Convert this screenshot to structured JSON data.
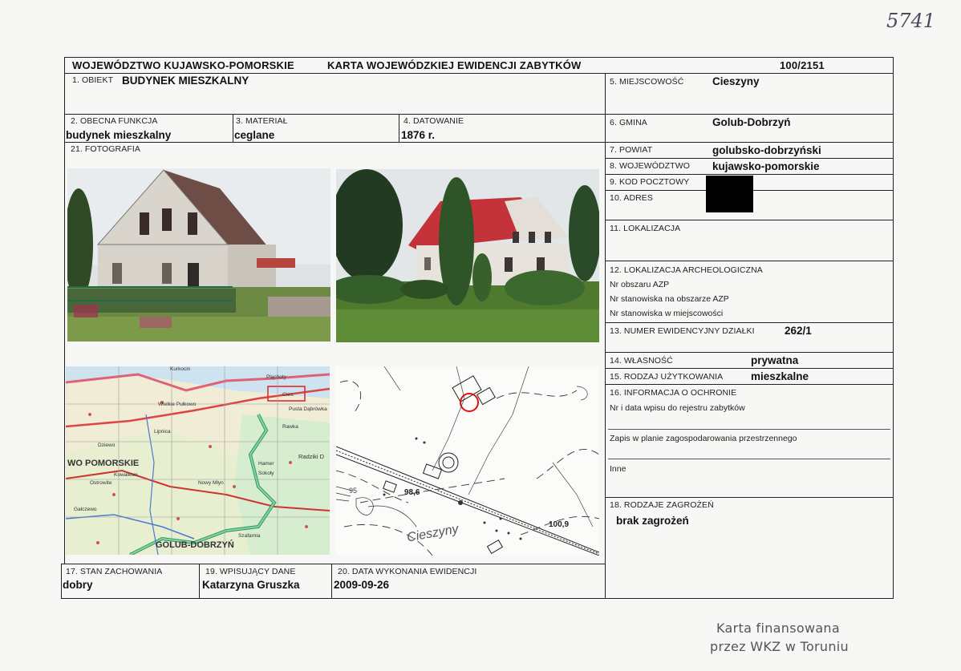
{
  "handwritten_number": "5741",
  "header": {
    "voivodeship": "WOJEWÓDZTWO KUJAWSKO-POMORSKIE",
    "title": "KARTA WOJEWÓDZKIEJ EWIDENCJI ZABYTKÓW",
    "number": "100/2151"
  },
  "fields": {
    "obiekt": {
      "label": "1. OBIEKT",
      "value": "BUDYNEK MIESZKALNY"
    },
    "funkcja": {
      "label": "2. OBECNA FUNKCJA",
      "value": "budynek mieszkalny"
    },
    "material": {
      "label": "3. MATERIAŁ",
      "value": "ceglane"
    },
    "datowanie": {
      "label": "4. DATOWANIE",
      "value": "1876 r."
    },
    "miejscowosc": {
      "label": "5. MIEJSCOWOŚĆ",
      "value": "Cieszyny"
    },
    "gmina": {
      "label": "6. GMINA",
      "value": "Golub-Dobrzyń"
    },
    "powiat": {
      "label": "7. POWIAT",
      "value": "golubsko-dobrzyński"
    },
    "wojewodztwo": {
      "label": "8. WOJEWÓDZTWO",
      "value": "kujawsko-pomorskie"
    },
    "kod": {
      "label": "9. KOD POCZTOWY"
    },
    "adres": {
      "label": "10. ADRES"
    },
    "lokalizacja": {
      "label": "11. LOKALIZACJA"
    },
    "archeo": {
      "label": "12. LOKALIZACJA ARCHEOLOGICZNA",
      "lines": [
        "Nr obszaru AZP",
        "Nr stanowiska na obszarze AZP",
        "Nr stanowiska w miejscowości"
      ]
    },
    "dzialka": {
      "label": "13. NUMER EWIDENCYJNY DZIAŁKI",
      "value": "262/1"
    },
    "wlasnosc": {
      "label": "14. WŁASNOŚĆ",
      "value": "prywatna"
    },
    "uzytkowanie": {
      "label": "15. RODZAJ UŻYTKOWANIA",
      "value": "mieszkalne"
    },
    "ochrona": {
      "label": "16. INFORMACJA O OCHRONIE",
      "line1": "Nr i data wpisu do rejestru zabytków",
      "line2": "Zapis w planie zagospodarowania przestrzennego",
      "line3": "Inne"
    },
    "zagrozenia": {
      "label": "18. RODZAJE ZAGROŻEŃ",
      "value": "brak zagrożeń"
    },
    "stan": {
      "label": "17. STAN ZACHOWANIA",
      "value": "dobry"
    },
    "wpisujacy": {
      "label": "19. WPISUJĄCY DANE",
      "value": "Katarzyna Gruszka"
    },
    "data": {
      "label": "20. DATA WYKONANIA EWIDENCJI",
      "value": "2009-09-26"
    },
    "fotografia": {
      "label": "21. FOTOGRAFIA"
    }
  },
  "map_region": {
    "labels": [
      "WO POMORSKIE",
      "GOLUB-DOBRZYŃ",
      "Lipnica",
      "Kowalewo",
      "Wielkie Pułkowo",
      "Cies.",
      "Rawka",
      "Radziki D",
      "Pusta Dąbrówka",
      "Ostrowite",
      "Hamer",
      "Sokoły",
      "Pląchoty",
      "Gałczewo",
      "Szafarnia",
      "Dziewo",
      "Kurkocin",
      "Nowy Młyn"
    ]
  },
  "map_local": {
    "labels": [
      "Cieszyny",
      "98,6",
      "100,9",
      "95"
    ]
  },
  "stamp": {
    "line1": "Karta finansowana",
    "line2": "przez WKZ w Toruniu"
  }
}
